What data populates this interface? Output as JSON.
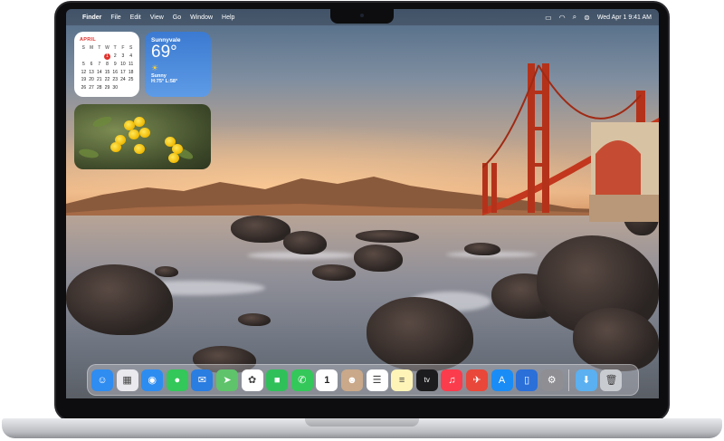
{
  "menubar": {
    "apple": "",
    "app_name": "Finder",
    "menus": [
      "File",
      "Edit",
      "View",
      "Go",
      "Window",
      "Help"
    ],
    "datetime": "Wed Apr 1  9:41 AM",
    "status_icons": [
      "screen-mirroring-icon",
      "wifi-icon",
      "search-icon",
      "control-center-icon"
    ]
  },
  "calendar_widget": {
    "month": "APRIL",
    "weekdays": [
      "S",
      "M",
      "T",
      "W",
      "T",
      "F",
      "S"
    ],
    "days": [
      "",
      "",
      "",
      "1",
      "2",
      "3",
      "4",
      "5",
      "6",
      "7",
      "8",
      "9",
      "10",
      "11",
      "12",
      "13",
      "14",
      "15",
      "16",
      "17",
      "18",
      "19",
      "20",
      "21",
      "22",
      "23",
      "24",
      "25",
      "26",
      "27",
      "28",
      "29",
      "30",
      "",
      ""
    ],
    "today": "1"
  },
  "weather_widget": {
    "city": "Sunnyvale",
    "temperature": "69°",
    "condition": "Sunny",
    "high_low": "H:75° L:58°"
  },
  "dock": {
    "apps": [
      {
        "name": "Finder",
        "icon": "finder-icon",
        "color": "#2f8cf0",
        "glyph": "☺"
      },
      {
        "name": "Launchpad",
        "icon": "launchpad-icon",
        "color": "#e9e9ee",
        "glyph": "▦"
      },
      {
        "name": "Safari",
        "icon": "safari-icon",
        "color": "#2d8cf0",
        "glyph": "◉"
      },
      {
        "name": "Messages",
        "icon": "messages-icon",
        "color": "#34c759",
        "glyph": "●"
      },
      {
        "name": "Mail",
        "icon": "mail-icon",
        "color": "#2a7de1",
        "glyph": "✉"
      },
      {
        "name": "Maps",
        "icon": "maps-icon",
        "color": "#5fc36b",
        "glyph": "➤"
      },
      {
        "name": "Photos",
        "icon": "photos-icon",
        "color": "#ffffff",
        "glyph": "✿"
      },
      {
        "name": "FaceTime",
        "icon": "facetime-icon",
        "color": "#30c05a",
        "glyph": "■"
      },
      {
        "name": "Phone",
        "icon": "phone-icon",
        "color": "#34c759",
        "glyph": "✆"
      },
      {
        "name": "Calendar",
        "icon": "calendar-icon",
        "color": "#ffffff",
        "glyph": "1"
      },
      {
        "name": "Contacts",
        "icon": "contacts-icon",
        "color": "#c9a98a",
        "glyph": "☻"
      },
      {
        "name": "Reminders",
        "icon": "reminders-icon",
        "color": "#ffffff",
        "glyph": "☰"
      },
      {
        "name": "Notes",
        "icon": "notes-icon",
        "color": "#fff4b8",
        "glyph": "≡"
      },
      {
        "name": "TV",
        "icon": "tv-icon",
        "color": "#1c1c1e",
        "glyph": "tv"
      },
      {
        "name": "Music",
        "icon": "music-icon",
        "color": "#fa3c4c",
        "glyph": "♫"
      },
      {
        "name": "Rocket",
        "icon": "rocket-icon",
        "color": "#e8473a",
        "glyph": "✈"
      },
      {
        "name": "App Store",
        "icon": "app-store-icon",
        "color": "#1a8cf5",
        "glyph": "A"
      },
      {
        "name": "iPhone Mirroring",
        "icon": "iphone-mirroring-icon",
        "color": "#2b6fd9",
        "glyph": "▯"
      },
      {
        "name": "System Settings",
        "icon": "settings-icon",
        "color": "#8e8e93",
        "glyph": "⚙"
      },
      {
        "name": "Downloads",
        "icon": "folder-icon",
        "color": "#5ab0f0",
        "glyph": "⬇"
      },
      {
        "name": "Trash",
        "icon": "trash-icon",
        "color": "#c8cbd0",
        "glyph": "🗑"
      }
    ]
  }
}
